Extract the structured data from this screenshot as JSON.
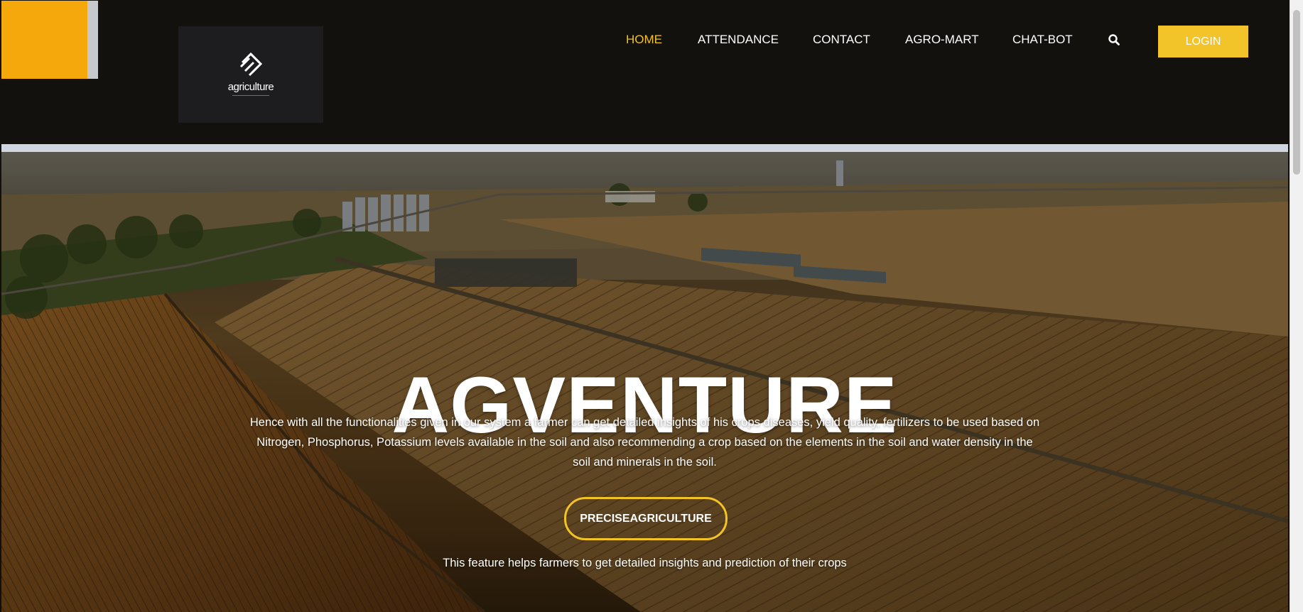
{
  "header": {
    "logo": {
      "icon": "agriculture-logo-icon",
      "text": "agriculture"
    },
    "nav": [
      {
        "label": "HOME",
        "active": true
      },
      {
        "label": "ATTENDANCE",
        "active": false
      },
      {
        "label": "CONTACT",
        "active": false
      },
      {
        "label": "AGRO-MART",
        "active": false
      },
      {
        "label": "CHAT-BOT",
        "active": false
      }
    ],
    "search_icon": "search-icon",
    "login_label": "LOGIN"
  },
  "hero": {
    "title": "AGVENTURE",
    "description": "Hence with all the functionalities given in our system a farmer can get detailed insights of his crops diseases, yield quality, fertilizers to be used based on Nitrogen, Phosphorus, Potassium levels available in the soil and also recommending a crop based on the elements in the soil and water density in the soil and minerals in the soil.",
    "cta_label": "PRECISEAGRICULTURE",
    "cta_caption": "This feature helps farmers to get detailed insights and prediction of their crops"
  },
  "colors": {
    "accent_yellow": "#f2c42a",
    "accent_orange": "#f4a80c",
    "header_bg": "#13110e",
    "nav_active": "#f2c224",
    "nav_text": "#ffffff"
  }
}
